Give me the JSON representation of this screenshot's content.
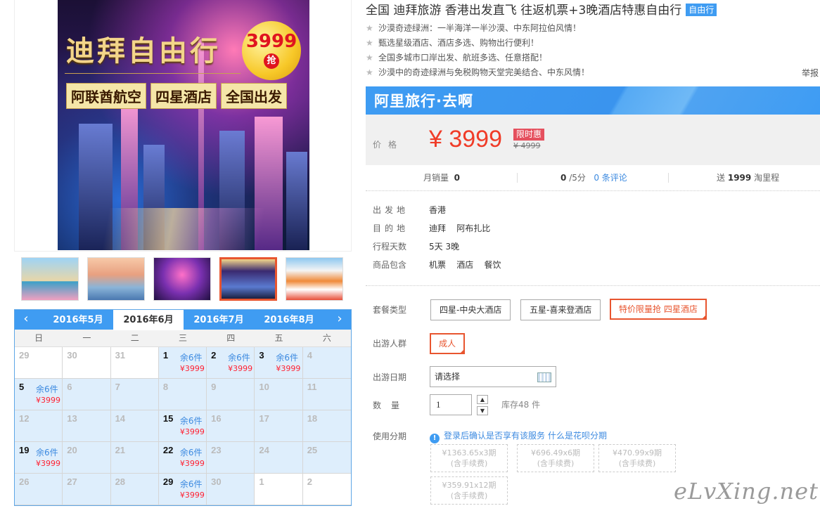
{
  "hero": {
    "headline": "迪拜自由行",
    "badge_price": "3999",
    "badge_word": "抢",
    "tags": [
      "阿联酋航空",
      "四星酒店",
      "全国出发"
    ]
  },
  "calendar": {
    "prev_icon": "‹",
    "next_icon": "›",
    "months": [
      "2016年5月",
      "2016年6月",
      "2016年7月",
      "2016年8月"
    ],
    "active_month": "2016年6月",
    "weekdays": [
      "日",
      "一",
      "二",
      "三",
      "四",
      "五",
      "六"
    ],
    "cells": [
      {
        "day": "29",
        "stock": "",
        "price": "",
        "available": false,
        "current_month": false
      },
      {
        "day": "30",
        "stock": "",
        "price": "",
        "available": false,
        "current_month": false
      },
      {
        "day": "31",
        "stock": "",
        "price": "",
        "available": false,
        "current_month": false
      },
      {
        "day": "1",
        "stock": "余6件",
        "price": "¥3999",
        "available": true,
        "current_month": true
      },
      {
        "day": "2",
        "stock": "余6件",
        "price": "¥3999",
        "available": true,
        "current_month": true
      },
      {
        "day": "3",
        "stock": "余6件",
        "price": "¥3999",
        "available": true,
        "current_month": true
      },
      {
        "day": "4",
        "stock": "",
        "price": "",
        "available": false,
        "current_month": true
      },
      {
        "day": "5",
        "stock": "余6件",
        "price": "¥3999",
        "available": true,
        "current_month": true
      },
      {
        "day": "6",
        "stock": "",
        "price": "",
        "available": false,
        "current_month": true
      },
      {
        "day": "7",
        "stock": "",
        "price": "",
        "available": false,
        "current_month": true
      },
      {
        "day": "8",
        "stock": "",
        "price": "",
        "available": false,
        "current_month": true
      },
      {
        "day": "9",
        "stock": "",
        "price": "",
        "available": false,
        "current_month": true
      },
      {
        "day": "10",
        "stock": "",
        "price": "",
        "available": false,
        "current_month": true
      },
      {
        "day": "11",
        "stock": "",
        "price": "",
        "available": false,
        "current_month": true
      },
      {
        "day": "12",
        "stock": "",
        "price": "",
        "available": false,
        "current_month": true
      },
      {
        "day": "13",
        "stock": "",
        "price": "",
        "available": false,
        "current_month": true
      },
      {
        "day": "14",
        "stock": "",
        "price": "",
        "available": false,
        "current_month": true
      },
      {
        "day": "15",
        "stock": "余6件",
        "price": "¥3999",
        "available": true,
        "current_month": true
      },
      {
        "day": "16",
        "stock": "",
        "price": "",
        "available": false,
        "current_month": true
      },
      {
        "day": "17",
        "stock": "",
        "price": "",
        "available": false,
        "current_month": true
      },
      {
        "day": "18",
        "stock": "",
        "price": "",
        "available": false,
        "current_month": true
      },
      {
        "day": "19",
        "stock": "余6件",
        "price": "¥3999",
        "available": true,
        "current_month": true
      },
      {
        "day": "20",
        "stock": "",
        "price": "",
        "available": false,
        "current_month": true
      },
      {
        "day": "21",
        "stock": "",
        "price": "",
        "available": false,
        "current_month": true
      },
      {
        "day": "22",
        "stock": "余6件",
        "price": "¥3999",
        "available": true,
        "current_month": true
      },
      {
        "day": "23",
        "stock": "",
        "price": "",
        "available": false,
        "current_month": true
      },
      {
        "day": "24",
        "stock": "",
        "price": "",
        "available": false,
        "current_month": true
      },
      {
        "day": "25",
        "stock": "",
        "price": "",
        "available": false,
        "current_month": true
      },
      {
        "day": "26",
        "stock": "",
        "price": "",
        "available": false,
        "current_month": true
      },
      {
        "day": "27",
        "stock": "",
        "price": "",
        "available": false,
        "current_month": true
      },
      {
        "day": "28",
        "stock": "",
        "price": "",
        "available": false,
        "current_month": true
      },
      {
        "day": "29",
        "stock": "余6件",
        "price": "¥3999",
        "available": true,
        "current_month": true
      },
      {
        "day": "30",
        "stock": "",
        "price": "",
        "available": false,
        "current_month": true
      },
      {
        "day": "1",
        "stock": "",
        "price": "",
        "available": false,
        "current_month": false
      },
      {
        "day": "2",
        "stock": "",
        "price": "",
        "available": false,
        "current_month": false
      }
    ]
  },
  "product": {
    "title": "全国 迪拜旅游 香港出发直飞 往返机票+3晚酒店特惠自由行",
    "title_badge": "自由行",
    "features": [
      "沙漠奇迹绿洲：一半海洋一半沙漠、中东阿拉伯风情！",
      "甄选星级酒店、酒店多选、购物出行便利！",
      "全国多城市口岸出发、航班多选、任意搭配！",
      "沙漠中的奇迹绿洲与免税购物天堂完美结合、中东风情！"
    ],
    "report": "举报",
    "brand": "阿里旅行·去啊"
  },
  "price": {
    "label": "价格",
    "current": "¥ 3999",
    "limit_badge": "限时惠",
    "original": "¥ 4999"
  },
  "stats": {
    "monthly_sales_label": "月销量",
    "monthly_sales": "0",
    "score": "0",
    "score_suffix": "/5分",
    "reviews_link": "0 条评论",
    "points_prefix": "送",
    "points": "1999",
    "points_suffix": "淘里程"
  },
  "info": [
    {
      "key": "出发地",
      "value": "香港"
    },
    {
      "key": "目的地",
      "value": "迪拜    阿布扎比"
    },
    {
      "key": "行程天数",
      "value": "5天 3晚"
    },
    {
      "key": "商品包含",
      "value": "机票    酒店    餐饮"
    }
  ],
  "options": {
    "package_label": "套餐类型",
    "packages": [
      "四星-中央大酒店",
      "五星-喜来登酒店",
      "特价限量抢 四星酒店"
    ],
    "selected_package": "特价限量抢 四星酒店",
    "people_label": "出游人群",
    "people": [
      "成人"
    ],
    "date_label": "出游日期",
    "date_value": "请选择",
    "qty_label": "数量",
    "qty_value": "1",
    "qty_up": "▲",
    "qty_down": "▼",
    "stock_text": "库存48 件",
    "installment_label": "使用分期",
    "installment_tip": "登录后确认是否享有该服务",
    "installment_link": "什么是花呗分期",
    "installments": [
      {
        "amount": "¥1363.65x3期",
        "fee": "(含手续费)"
      },
      {
        "amount": "¥696.49x6期",
        "fee": "(含手续费)"
      },
      {
        "amount": "¥470.99x9期",
        "fee": "(含手续费)"
      },
      {
        "amount": "¥359.91x12期",
        "fee": "(含手续费)"
      }
    ]
  },
  "watermark": "eLvXing.net",
  "colors": {
    "accent": "#3f9cf2",
    "price": "#f03c28",
    "selected": "#e8552f",
    "link": "#3c8ae0"
  }
}
